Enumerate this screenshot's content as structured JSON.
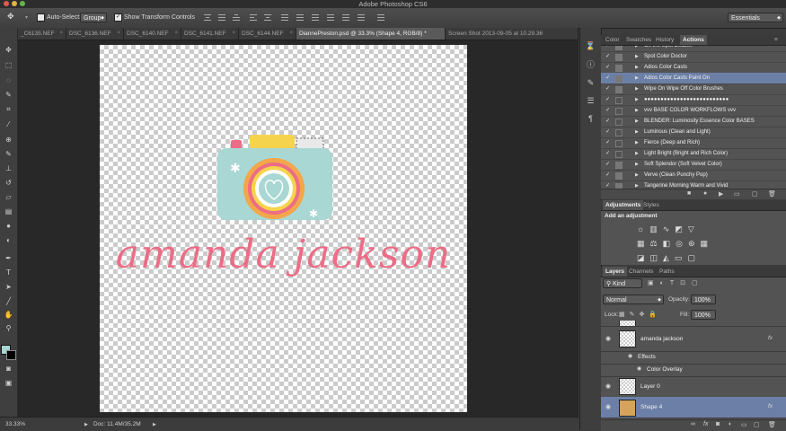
{
  "title": "Adobe Photoshop CS6",
  "options": {
    "auto_select_label": "Auto-Select:",
    "auto_select_value": "Group",
    "transform_label": "Show Transform Controls",
    "workspace": "Essentials"
  },
  "tabs": [
    {
      "label": "_C6135.NEF"
    },
    {
      "label": "DSC_6136.NEF"
    },
    {
      "label": "DSC_6140.NEF"
    },
    {
      "label": "DSC_6141.NEF"
    },
    {
      "label": "DSC_6144.NEF"
    },
    {
      "label": "DiannePreston.psd @ 33.3% (Shape 4, RGB/8) *"
    },
    {
      "label": "Screen Shot 2013-09-05 at 10.29.36"
    }
  ],
  "canvas": {
    "logo_text": "amanda jackson",
    "colors": {
      "pink": "#ec6d86",
      "mint": "#a9d7d3",
      "yellow": "#f6d34c",
      "orange": "#f4a64a"
    }
  },
  "status": {
    "zoom": "33.33%",
    "doc": "Doc: 11.4M/35.2M"
  },
  "actions_panel": {
    "tabs": [
      "Color",
      "Swatches",
      "History",
      "Actions"
    ],
    "items": [
      {
        "label": "Off the Spot Detailer",
        "checked": true,
        "dialog": true
      },
      {
        "label": "Spot Color Doctor",
        "checked": true,
        "dialog": true
      },
      {
        "label": "Adios Color Casts",
        "checked": true,
        "dialog": true
      },
      {
        "label": "Adios Color Casts Paint On",
        "checked": true,
        "dialog": true
      },
      {
        "label": "Wipe On Wipe Off Color Brushes",
        "checked": true,
        "dialog": true
      },
      {
        "label": "●●●●●●●●●●●●●●●●●●●●●●●●●●",
        "checked": true,
        "dialog": false
      },
      {
        "label": "vvv  BASE COLOR WORKFLOWS  vvv",
        "checked": true,
        "dialog": false
      },
      {
        "label": "BLENDER: Luminosity Essence Color BASES",
        "checked": true,
        "dialog": false
      },
      {
        "label": "Luminous (Clean and Light)",
        "checked": true,
        "dialog": false
      },
      {
        "label": "Fierce (Deep and Rich)",
        "checked": true,
        "dialog": false
      },
      {
        "label": "Light Bright (Bright and Rich Color)",
        "checked": true,
        "dialog": false
      },
      {
        "label": "Soft Splendor (Soft Velvet Color)",
        "checked": true,
        "dialog": true
      },
      {
        "label": "Verve (Clean Punchy Pop)",
        "checked": true,
        "dialog": true
      },
      {
        "label": "Tangerine Morning Warm and Vivid",
        "checked": true,
        "dialog": true
      }
    ]
  },
  "adjustments_panel": {
    "tabs": [
      "Adjustments",
      "Styles"
    ],
    "heading": "Add an adjustment"
  },
  "layers_panel": {
    "tabs": [
      "Layers",
      "Channels",
      "Paths"
    ],
    "filter": "Kind",
    "blend_mode": "Normal",
    "opacity_label": "Opacity:",
    "opacity": "100%",
    "lock_label": "Lock:",
    "fill_label": "Fill:",
    "fill": "100%",
    "layers": [
      {
        "name": "amanda jackson",
        "fx": "fx"
      },
      {
        "name": "Effects"
      },
      {
        "name": "Color Overlay"
      },
      {
        "name": "Layer 0"
      },
      {
        "name": "Shape 4",
        "fx": "fx"
      }
    ]
  }
}
